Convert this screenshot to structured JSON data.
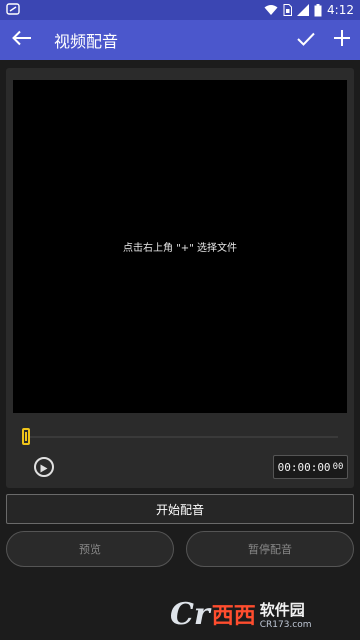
{
  "status_bar": {
    "time": "4:12"
  },
  "app_bar": {
    "title": "视频配音"
  },
  "video": {
    "hint": "点击右上角 \"+\" 选择文件"
  },
  "player": {
    "time_main": "00:00:00",
    "time_sub": "00"
  },
  "buttons": {
    "record": "开始配音",
    "preview": "预览",
    "pause": "暂停配音"
  },
  "watermark": {
    "logo_text": "Cr",
    "logo_mark": "西西",
    "name": "软件园",
    "url": "CR173.com"
  },
  "colors": {
    "status_bar": "#3b46b3",
    "app_bar": "#4b57cc",
    "timeline_handle": "#f0c51a",
    "background": "#1c1c1c"
  }
}
